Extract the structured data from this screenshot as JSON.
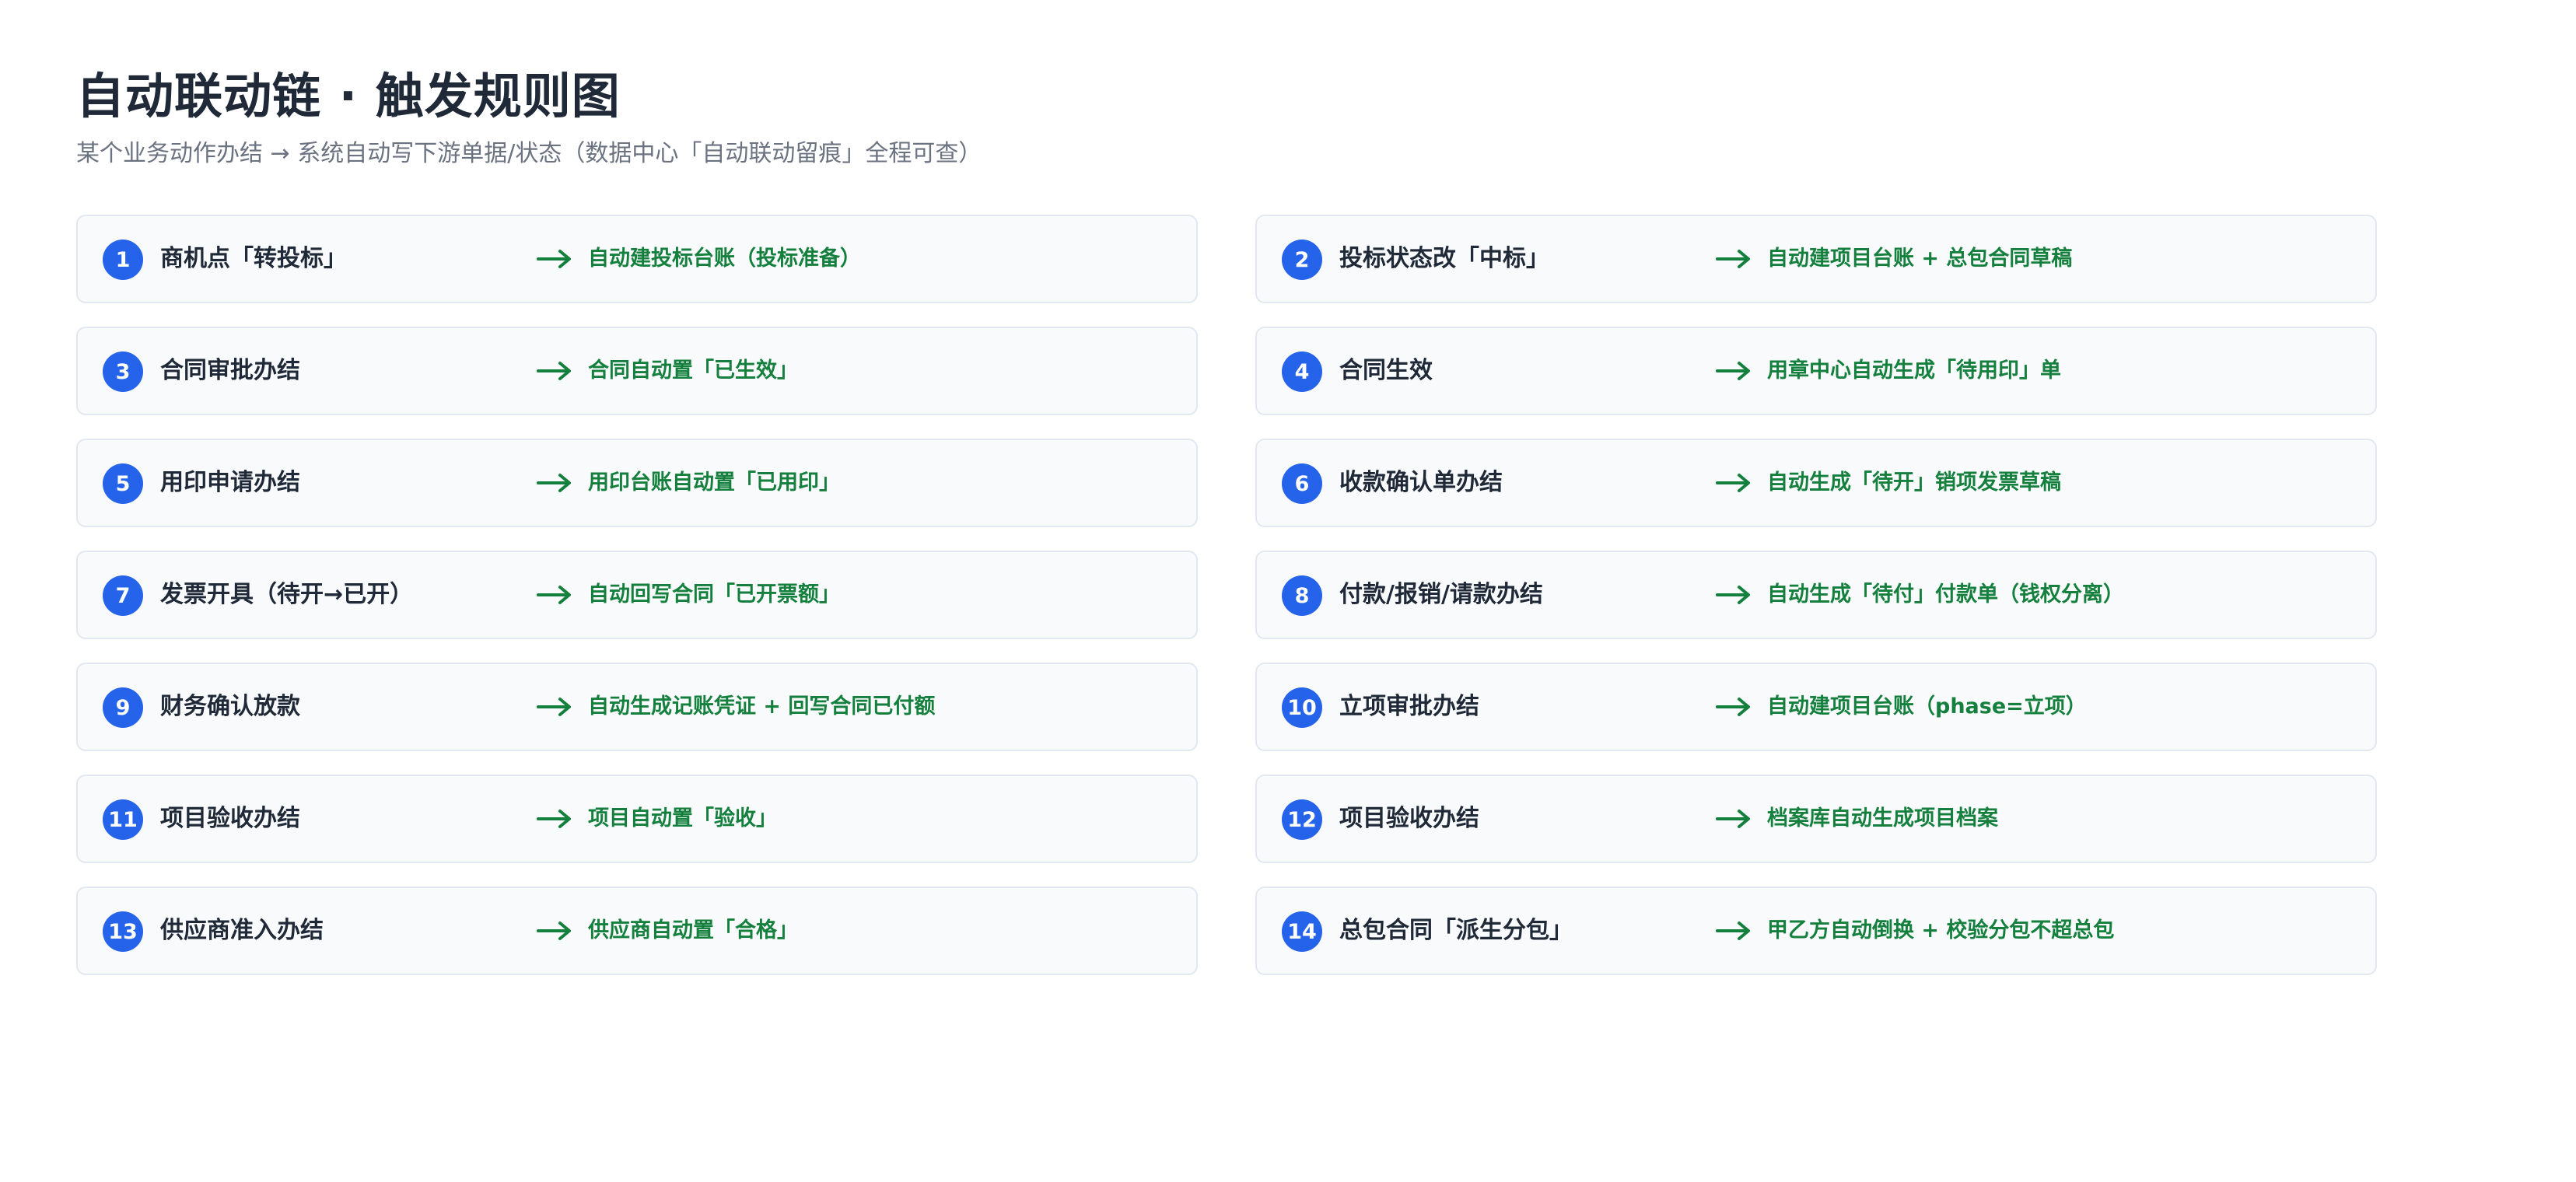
{
  "header": {
    "title": "自动联动链 · 触发规则图",
    "subtitle": "某个业务动作办结 → 系统自动写下游单据/状态（数据中心「自动联动留痕」全程可查）"
  },
  "colors": {
    "badge": "#2563eb",
    "effect_text": "#15803d",
    "arrow": "#15803d",
    "card_bg": "#f8fafc",
    "card_border": "#e2e8f0"
  },
  "rules": [
    {
      "num": "1",
      "trigger": "商机点「转投标」",
      "effect": "自动建投标台账（投标准备）"
    },
    {
      "num": "2",
      "trigger": "投标状态改「中标」",
      "effect": "自动建项目台账 + 总包合同草稿"
    },
    {
      "num": "3",
      "trigger": "合同审批办结",
      "effect": "合同自动置「已生效」"
    },
    {
      "num": "4",
      "trigger": "合同生效",
      "effect": "用章中心自动生成「待用印」单"
    },
    {
      "num": "5",
      "trigger": "用印申请办结",
      "effect": "用印台账自动置「已用印」"
    },
    {
      "num": "6",
      "trigger": "收款确认单办结",
      "effect": "自动生成「待开」销项发票草稿"
    },
    {
      "num": "7",
      "trigger": "发票开具（待开→已开）",
      "effect": "自动回写合同「已开票额」"
    },
    {
      "num": "8",
      "trigger": "付款/报销/请款办结",
      "effect": "自动生成「待付」付款单（钱权分离）"
    },
    {
      "num": "9",
      "trigger": "财务确认放款",
      "effect": "自动生成记账凭证 + 回写合同已付额"
    },
    {
      "num": "10",
      "trigger": "立项审批办结",
      "effect": "自动建项目台账（phase=立项）"
    },
    {
      "num": "11",
      "trigger": "项目验收办结",
      "effect": "项目自动置「验收」"
    },
    {
      "num": "12",
      "trigger": "项目验收办结",
      "effect": "档案库自动生成项目档案"
    },
    {
      "num": "13",
      "trigger": "供应商准入办结",
      "effect": "供应商自动置「合格」"
    },
    {
      "num": "14",
      "trigger": "总包合同「派生分包」",
      "effect": "甲乙方自动倒换 + 校验分包不超总包"
    }
  ]
}
